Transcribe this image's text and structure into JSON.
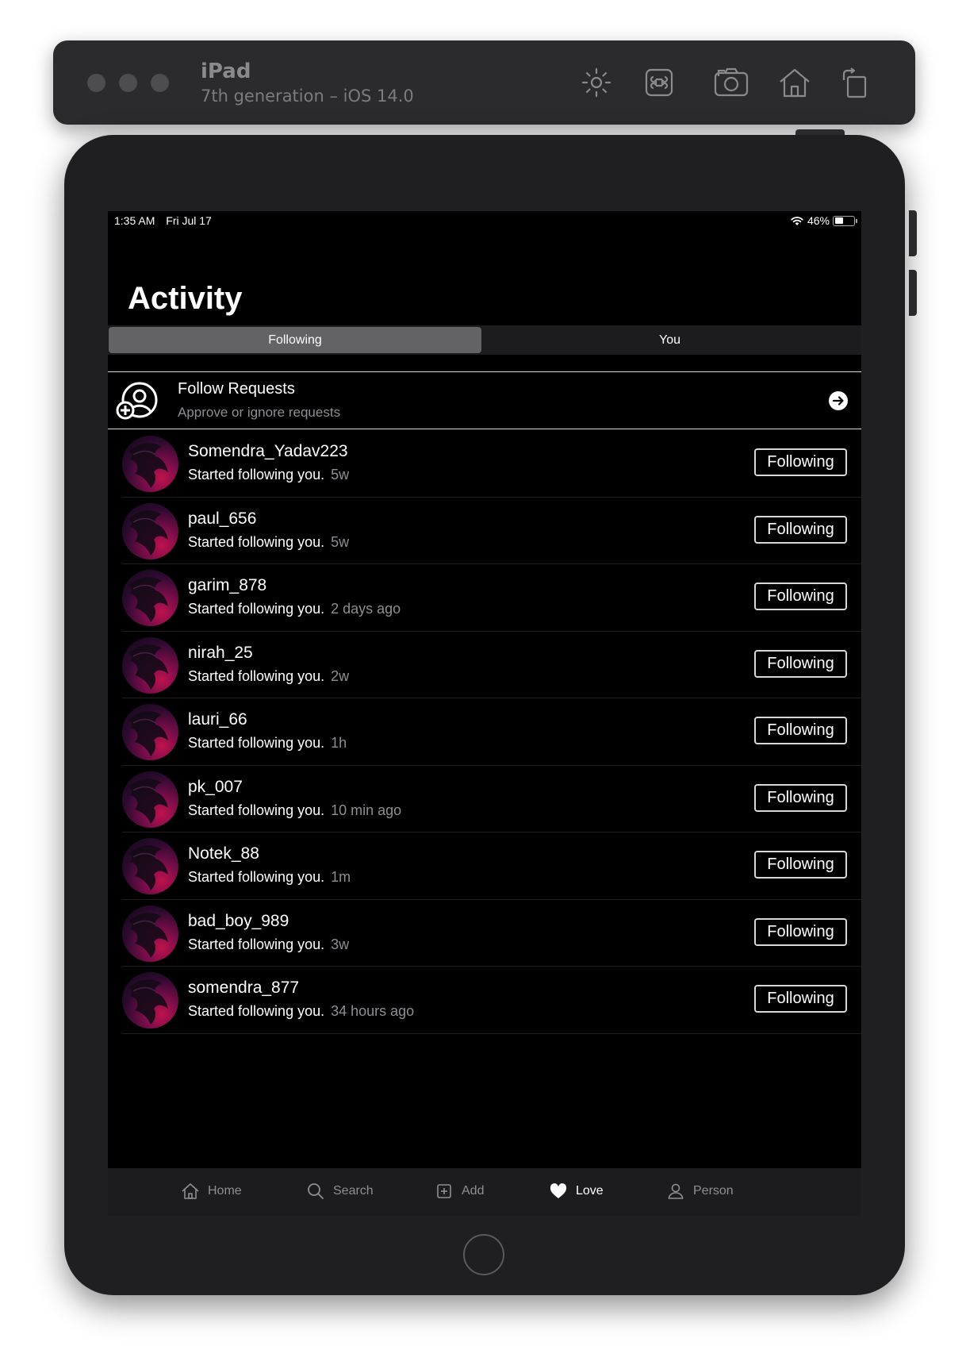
{
  "simulator": {
    "title": "iPad",
    "subtitle": "7th generation – iOS 14.0",
    "tools": [
      "brightness-icon",
      "command-icon",
      "screenshot-icon",
      "home-icon",
      "rotate-icon"
    ]
  },
  "status_bar": {
    "time": "1:35 AM",
    "date": "Fri Jul 17",
    "battery": "46%",
    "battery_level": 0.46
  },
  "page": {
    "title": "Activity"
  },
  "segments": {
    "following": "Following",
    "you": "You",
    "selected": "Following"
  },
  "follow_requests": {
    "title": "Follow Requests",
    "subtitle": "Approve or ignore requests"
  },
  "activity": [
    {
      "username": "Somendra_Yadav223",
      "text": "Started following you.",
      "time": "5w",
      "button": "Following"
    },
    {
      "username": "paul_656",
      "text": "Started following you.",
      "time": "5w",
      "button": "Following"
    },
    {
      "username": "garim_878",
      "text": "Started following you.",
      "time": "2 days ago",
      "button": "Following"
    },
    {
      "username": "nirah_25",
      "text": "Started following you.",
      "time": "2w",
      "button": "Following"
    },
    {
      "username": "lauri_66",
      "text": "Started following you.",
      "time": "1h",
      "button": "Following"
    },
    {
      "username": "pk_007",
      "text": "Started following you.",
      "time": "10 min ago",
      "button": "Following"
    },
    {
      "username": "Notek_88",
      "text": "Started following you.",
      "time": "1m",
      "button": "Following"
    },
    {
      "username": "bad_boy_989",
      "text": "Started following you.",
      "time": "3w",
      "button": "Following"
    },
    {
      "username": "somendra_877",
      "text": "Started following you.",
      "time": "34 hours ago",
      "button": "Following"
    }
  ],
  "tabbar": {
    "home": "Home",
    "search": "Search",
    "add": "Add",
    "love": "Love",
    "person": "Person",
    "active": "Love"
  }
}
